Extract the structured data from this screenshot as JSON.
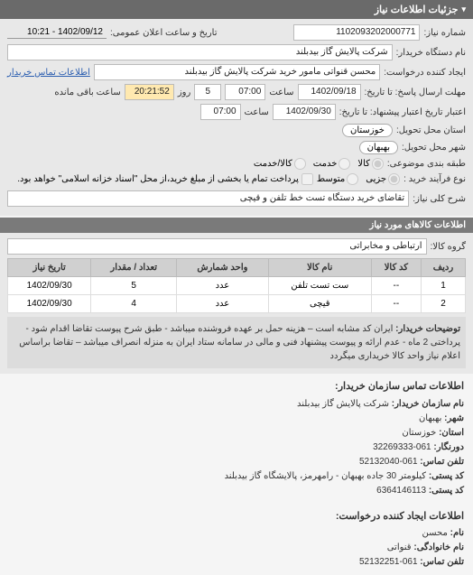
{
  "header": {
    "title": "جزئیات اطلاعات نیاز"
  },
  "need": {
    "number_label": "شماره نیاز:",
    "number": "1102093202000771",
    "announce_label": "تاریخ و ساعت اعلان عمومی:",
    "announce": "1402/09/12 - 10:21",
    "buyer_org_label": "نام دستگاه خریدار:",
    "buyer_org": "شرکت پالایش گاز بیدبلند",
    "creator_label": "ایجاد کننده درخواست:",
    "creator": "محسن قنواتی مامور خرید شرکت پالایش گاز بیدبلند",
    "buyer_contact_link": "اطلاعات تماس خریدار",
    "deadline_label": "مهلت ارسال پاسخ: تا تاریخ:",
    "deadline_date": "1402/09/18",
    "deadline_time_label": "ساعت",
    "deadline_time": "07:00",
    "days_label": "روز",
    "days": "5",
    "remain_label": "ساعت باقی مانده",
    "remain": "20:21:52",
    "validity_label": "اعتبار تاریخ اعتبار پیشنهاد: تا تاریخ:",
    "validity_date": "1402/09/30",
    "validity_time_label": "ساعت",
    "validity_time": "07:00",
    "province_label": "استان محل تحویل:",
    "province": "خوزستان",
    "city_label": "شهر محل تحویل:",
    "city": "بهبهان",
    "class_label": "طبقه بندی موضوعی:",
    "class_opts": {
      "a": "کالا",
      "b": "خدمت",
      "c": "کالا/خدمت"
    },
    "process_label": "نوع فرآیند خرید :",
    "process_opts": {
      "a": "جزیی",
      "b": "متوسط"
    },
    "process_note": "پرداخت تمام یا بخشی از مبلغ خرید،از محل \"اسناد خزانه اسلامی\" خواهد بود.",
    "desc_label": "شرح کلی نیاز:",
    "desc": "تقاضای خرید دستگاه تست خط تلفن و قیچی"
  },
  "items_header": "اطلاعات کالاهای مورد نیاز",
  "group_label": "گروه کالا:",
  "group": "ارتباطی و مخابراتی",
  "table": {
    "headers": [
      "ردیف",
      "کد کالا",
      "نام کالا",
      "واحد شمارش",
      "تعداد / مقدار",
      "تاریخ نیاز"
    ],
    "rows": [
      {
        "idx": "1",
        "code": "--",
        "name": "ست تست تلفن",
        "unit": "عدد",
        "qty": "5",
        "date": "1402/09/30"
      },
      {
        "idx": "2",
        "code": "--",
        "name": "قیچی",
        "unit": "عدد",
        "qty": "4",
        "date": "1402/09/30"
      }
    ]
  },
  "buyer_note_label": "توضیحات خریدار:",
  "buyer_note": "ایران کد مشابه است – هزینه حمل بر عهده فروشنده میباشد - طبق شرح پیوست تقاضا اقدام شود - پرداختی 2 ماه - عدم ارائه و پیوست پیشنهاد فنی و مالی در سامانه ستاد ایران به منزله انصراف میباشد – تقاضا براساس اعلام نیاز واحد کالا خریداری میگردد",
  "contact_buyer": {
    "title": "اطلاعات تماس سازمان خریدار:",
    "org_label": "نام سازمان خریدار:",
    "org": "شرکت پالایش گاز بیدبلند",
    "city_label": "شهر:",
    "city": "بهبهان",
    "province_label": "استان:",
    "province": "خوزستان",
    "tel_label": "دورنگار:",
    "tel": "061-32269333",
    "fax_label": "تلفن تماس:",
    "fax": "061-52132040",
    "postal_label": "کد پستی:",
    "postal": "کیلومتر 30 جاده بهبهان - رامهرمز، پالایشگاه گاز بیدبلند",
    "zip_label": "کد پستی:",
    "zip": "6364146113"
  },
  "contact_creator": {
    "title": "اطلاعات ایجاد کننده درخواست:",
    "fname_label": "نام:",
    "fname": "محسن",
    "lname_label": "نام خانوادگی:",
    "lname": "قنواتی",
    "tel_label": "تلفن تماس:",
    "tel": "061-52132251"
  }
}
